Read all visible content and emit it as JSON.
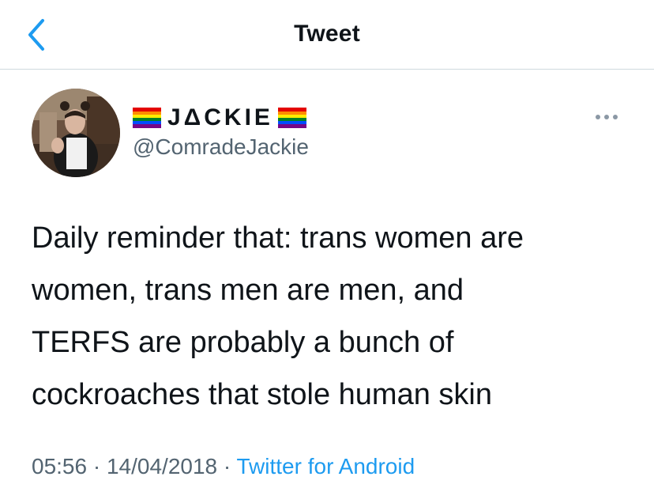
{
  "header": {
    "title": "Tweet",
    "back_icon": "chevron-left-icon",
    "accent_color": "#1d9bf0"
  },
  "author": {
    "display_name": "JΔCKIE",
    "handle": "@ComradeJackie",
    "name_emoji": "rainbow-flag-icon"
  },
  "tweet": {
    "lines": [
      "Daily reminder that: trans women are",
      "women, trans men are men, and",
      "TERFS are probably a bunch of",
      "cockroaches that stole human skin"
    ]
  },
  "meta": {
    "time": "05:56",
    "separator": "·",
    "date": "14/04/2018",
    "source": "Twitter for Android"
  }
}
